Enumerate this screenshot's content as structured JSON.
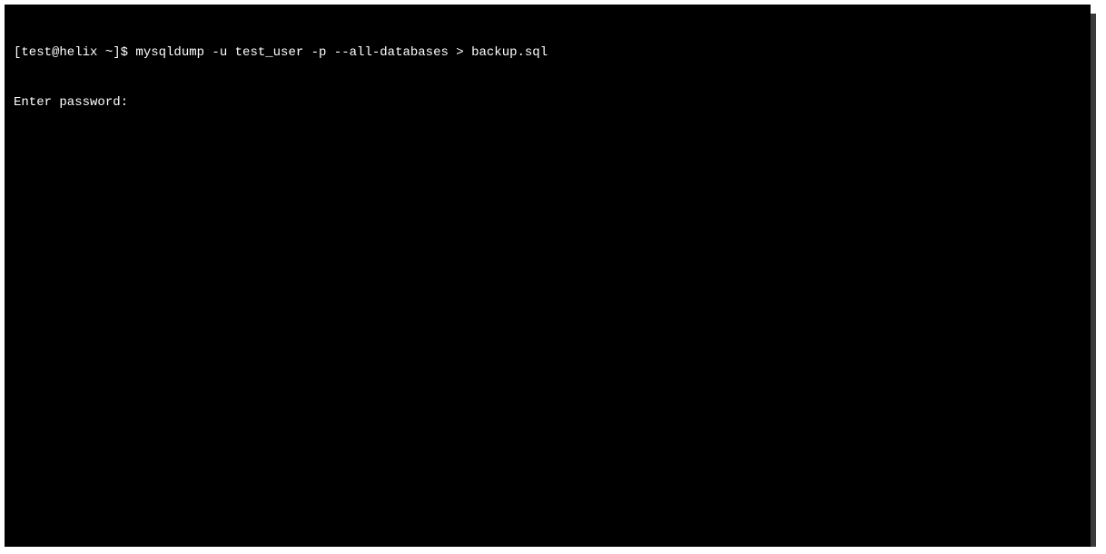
{
  "terminal": {
    "lines": [
      "[test@helix ~]$ mysqldump -u test_user -p --all-databases > backup.sql",
      "Enter password:"
    ]
  }
}
